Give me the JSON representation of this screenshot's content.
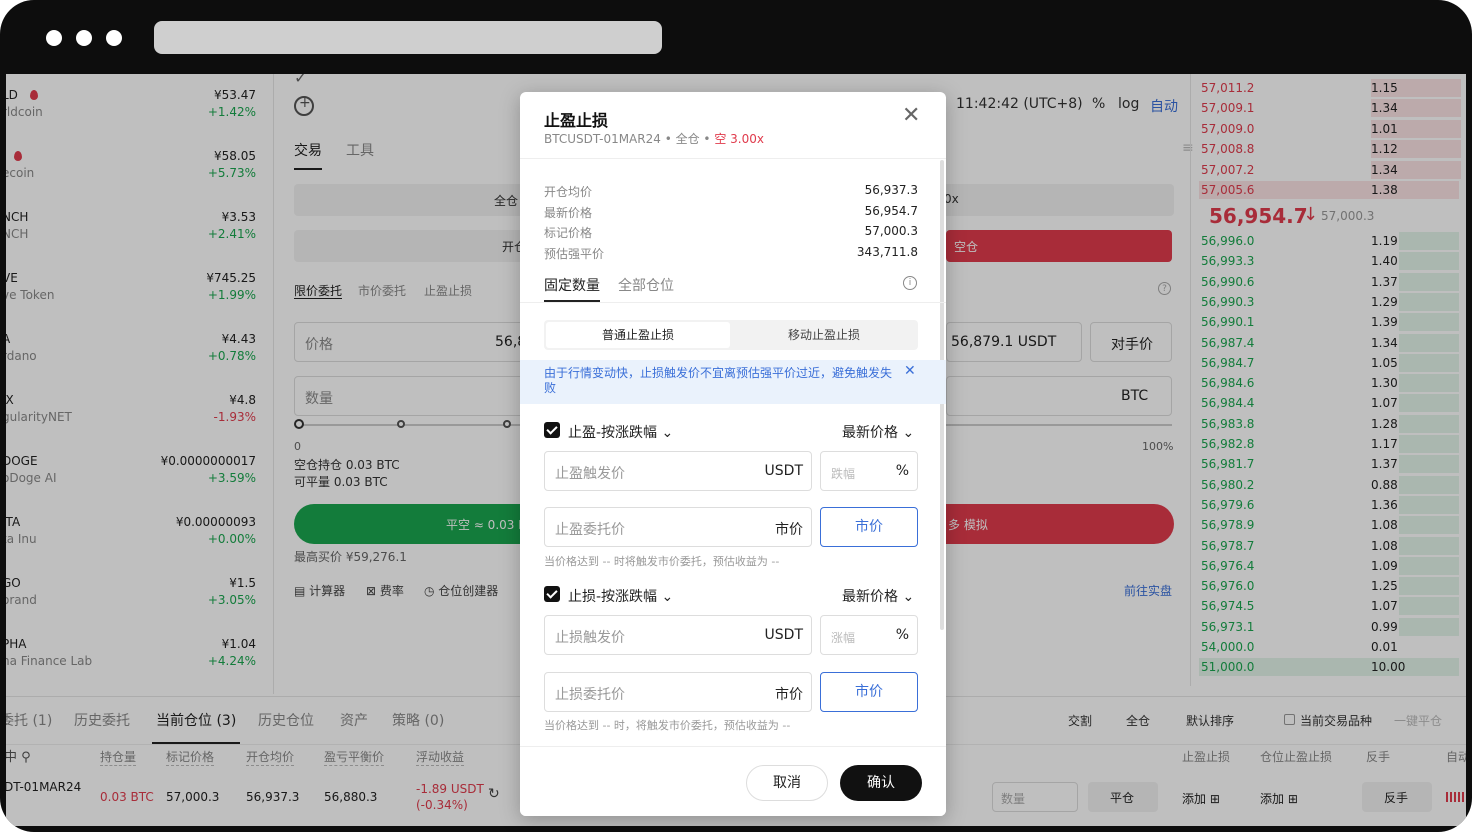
{
  "window": {
    "controls": [
      "close",
      "minimize",
      "maximize"
    ]
  },
  "coins": [
    {
      "sym": "LD",
      "name": "rldcoin",
      "price": "¥53.47",
      "change": "+1.42%",
      "up": true,
      "fire": true
    },
    {
      "sym": "",
      "name": "ecoin",
      "price": "¥58.05",
      "change": "+5.73%",
      "up": true,
      "fire": true
    },
    {
      "sym": "NCH",
      "name": "NCH",
      "price": "¥3.53",
      "change": "+2.41%",
      "up": true
    },
    {
      "sym": "VE",
      "name": "ve Token",
      "price": "¥745.25",
      "change": "+1.99%",
      "up": true
    },
    {
      "sym": "A",
      "name": "rdano",
      "price": "¥4.43",
      "change": "+0.78%",
      "up": true
    },
    {
      "sym": "IX",
      "name": "gularityNET",
      "price": "¥4.8",
      "change": "-1.93%",
      "up": false
    },
    {
      "sym": "DOGE",
      "name": "oDoge AI",
      "price": "¥0.0000000017",
      "change": "+3.59%",
      "up": true
    },
    {
      "sym": "ITA",
      "name": "ta Inu",
      "price": "¥0.00000093",
      "change": "+0.00%",
      "up": true
    },
    {
      "sym": "GO",
      "name": "orand",
      "price": "¥1.5",
      "change": "+3.05%",
      "up": true
    },
    {
      "sym": "PHA",
      "name": "ha Finance Lab",
      "price": "¥1.04",
      "change": "+4.24%",
      "up": true
    }
  ],
  "header": {
    "time": "11:42:42 (UTC+8)",
    "pct": "%",
    "log": "log",
    "auto": "自动"
  },
  "trade": {
    "tab_trade": "交易",
    "tab_tools": "工具",
    "margin": "全仓",
    "open": "开仓",
    "order_types": [
      "限价委托",
      "市价委托",
      "止盈止损"
    ],
    "price_label": "价格",
    "price_partial": "56,8",
    "qty_label": "数量",
    "slider_min": "0",
    "slider_max": "100%",
    "hold": "空仓持仓 0.03 BTC",
    "closable": "可平量 0.03 BTC",
    "close_short": "平空 ≈ 0.03 B",
    "max_buy": "最高买价 ¥59,276.1",
    "tools": [
      "计算器",
      "费率",
      "仓位创建器"
    ],
    "right_price": "56,879.1  USDT",
    "counter_price": "对手价",
    "unit": "BTC",
    "lev": "0x",
    "red_btn": "空仓",
    "short_btn": "多 模拟",
    "live": "前往实盘"
  },
  "orderbook": {
    "asks": [
      [
        "57,011.2",
        "1.15"
      ],
      [
        "57,009.1",
        "1.34"
      ],
      [
        "57,009.0",
        "1.01"
      ],
      [
        "57,008.8",
        "1.12"
      ],
      [
        "57,007.2",
        "1.34"
      ],
      [
        "57,005.6",
        "1.38"
      ]
    ],
    "last": "56,954.7",
    "mark": "57,000.3",
    "bids": [
      [
        "56,996.0",
        "1.19"
      ],
      [
        "56,993.3",
        "1.40"
      ],
      [
        "56,990.6",
        "1.37"
      ],
      [
        "56,990.3",
        "1.29"
      ],
      [
        "56,990.1",
        "1.39"
      ],
      [
        "56,987.4",
        "1.34"
      ],
      [
        "56,984.7",
        "1.05"
      ],
      [
        "56,984.6",
        "1.30"
      ],
      [
        "56,984.4",
        "1.07"
      ],
      [
        "56,983.8",
        "1.28"
      ],
      [
        "56,982.8",
        "1.17"
      ],
      [
        "56,981.7",
        "1.37"
      ],
      [
        "56,980.2",
        "0.88"
      ],
      [
        "56,979.6",
        "1.36"
      ],
      [
        "56,978.9",
        "1.08"
      ],
      [
        "56,978.7",
        "1.08"
      ],
      [
        "56,976.4",
        "1.09"
      ],
      [
        "56,976.0",
        "1.25"
      ],
      [
        "56,974.5",
        "1.07"
      ],
      [
        "56,973.1",
        "0.99"
      ],
      [
        "54,000.0",
        "0.01"
      ],
      [
        "51,000.0",
        "10.00"
      ]
    ]
  },
  "bottom": {
    "tabs": [
      "委托 (1)",
      "历史委托",
      "当前仓位 (3)",
      "历史仓位",
      "资产",
      "策略 (0)"
    ],
    "filters": [
      "交割",
      "全仓",
      "默认排序",
      "当前交易品种",
      "一键平仓"
    ],
    "cols": [
      "持仓量",
      "标记价格",
      "开仓均价",
      "盈亏平衡价",
      "浮动收益"
    ],
    "cols_right": [
      "止盈止损",
      "仓位止盈止损",
      "反手",
      "自动"
    ],
    "row": {
      "inst": "DT-01MAR24",
      "qty": "0.03 BTC",
      "mark": "57,000.3",
      "avg": "56,937.3",
      "be": "56,880.3",
      "pnl": "-1.89 USDT",
      "pnl_pct": "(-0.34%)",
      "qty_ph": "数量",
      "close": "平仓",
      "add1": "添加",
      "add2": "添加",
      "flip": "反手"
    }
  },
  "modal": {
    "title": "止盈止损",
    "subtitle": "BTCUSDT-01MAR24 • 全仓 •",
    "side": "空 3.00x",
    "info": [
      {
        "label": "开仓均价",
        "value": "56,937.3"
      },
      {
        "label": "最新价格",
        "value": "56,954.7"
      },
      {
        "label": "标记价格",
        "value": "57,000.3"
      },
      {
        "label": "预估强平价",
        "value": "343,711.8"
      }
    ],
    "tab_fixed": "固定数量",
    "tab_all": "全部仓位",
    "seg_normal": "普通止盈止损",
    "seg_trailing": "移动止盈止损",
    "warning": "由于行情变动快，止损触发价不宜离预估强平价过近，避免触发失败",
    "tp_title": "止盈-按涨跌幅",
    "tp_price_type": "最新价格",
    "tp_trigger_ph": "止盈触发价",
    "tp_trigger_unit": "USDT",
    "tp_pct_ph": "跌幅",
    "pct": "%",
    "tp_order_ph": "止盈委托价",
    "market_unit": "市价",
    "market_btn": "市价",
    "tp_note": "当价格达到 -- 时将触发市价委托，预估收益为 --",
    "sl_title": "止损-按涨跌幅",
    "sl_price_type": "最新价格",
    "sl_trigger_ph": "止损触发价",
    "sl_trigger_unit": "USDT",
    "sl_pct_ph": "涨幅",
    "sl_order_ph": "止损委托价",
    "sl_note": "当价格达到 -- 时，将触发市价委托，预估收益为 --",
    "cancel": "取消",
    "confirm": "确认"
  }
}
